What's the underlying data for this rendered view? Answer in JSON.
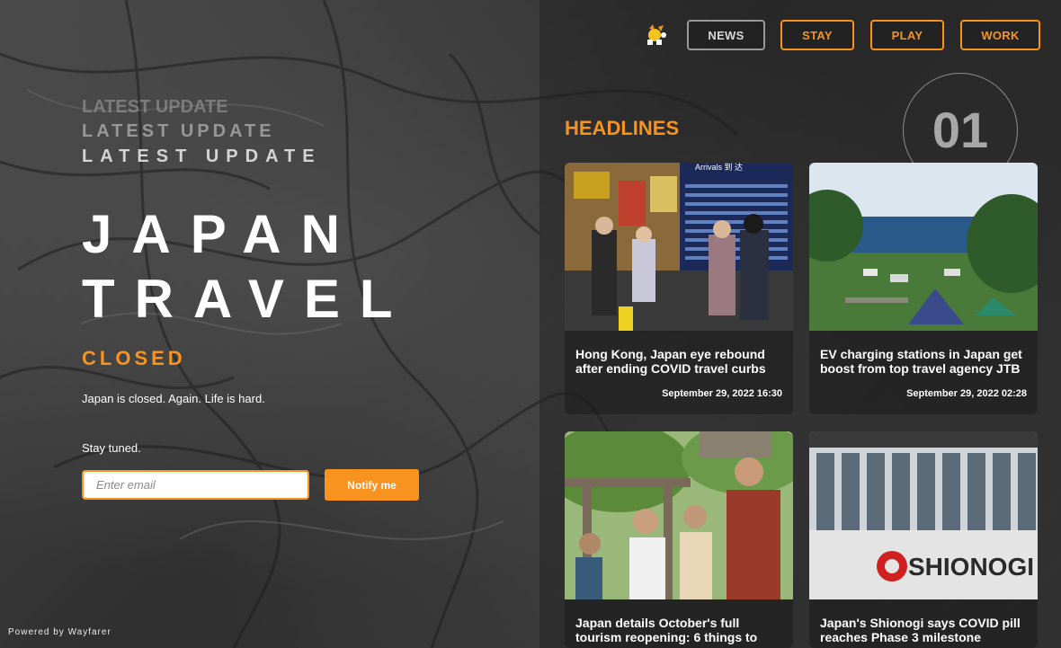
{
  "nav": {
    "items": [
      {
        "label": "NEWS"
      },
      {
        "label": "STAY"
      },
      {
        "label": "PLAY"
      },
      {
        "label": "WORK"
      }
    ]
  },
  "hero": {
    "kicker": [
      "LATEST UPDATE",
      "LATEST UPDATE",
      "LATEST UPDATE"
    ],
    "title_line1": "JAPAN",
    "title_line2": "TRAVEL",
    "status": "CLOSED",
    "message": "Japan is closed. Again. Life is hard.",
    "stay_tuned": "Stay tuned.",
    "email_placeholder": "Enter email",
    "notify_label": "Notify me"
  },
  "footer": {
    "powered_by": "Powered by Wayfarer"
  },
  "headlines": {
    "heading": "HEADLINES",
    "counter": "01",
    "cards": [
      {
        "title": "Hong Kong, Japan eye rebound after ending COVID travel curbs",
        "date": "September 29, 2022 16:30"
      },
      {
        "title": "EV charging stations in Japan get boost from top travel agency JTB",
        "date": "September 29, 2022 02:28"
      },
      {
        "title": "Japan details October's full tourism reopening: 6 things to",
        "date": ""
      },
      {
        "title": "Japan's Shionogi says COVID pill reaches Phase 3 milestone",
        "date": ""
      }
    ]
  },
  "photos": {
    "card1_sign": "Arrivals 到 达",
    "card4_sign": "SHIONOGI"
  },
  "colors": {
    "accent": "#f7931e",
    "nav_muted": "#9a9a9a"
  }
}
